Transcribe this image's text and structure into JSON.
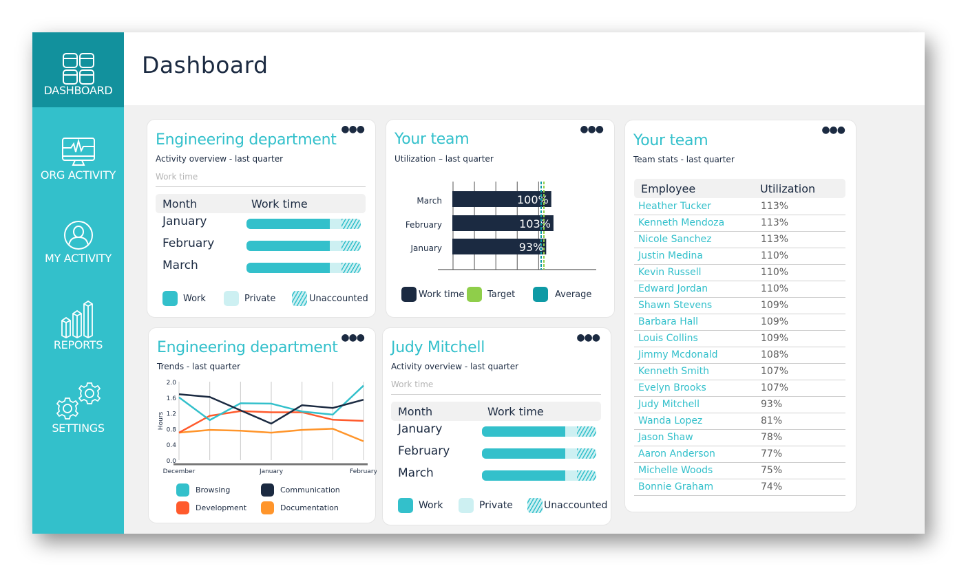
{
  "sidebar": {
    "items": [
      {
        "label": "DASHBOARD",
        "icon": "dashboard-grid-icon",
        "active": true
      },
      {
        "label": "ORG ACTIVITY",
        "icon": "monitor-pulse-icon",
        "active": false
      },
      {
        "label": "MY ACTIVITY",
        "icon": "user-circle-icon",
        "active": false
      },
      {
        "label": "REPORTS",
        "icon": "bar-chart-3d-icon",
        "active": false
      },
      {
        "label": "SETTINGS",
        "icon": "gears-icon",
        "active": false
      }
    ]
  },
  "header": {
    "title": "Dashboard"
  },
  "colors": {
    "accent": "#33c0cb",
    "accent_dark": "#12919d",
    "navy": "#1b2a41",
    "private": "#cdf0f2",
    "target": "#8fce4a",
    "average": "#0e9aa5"
  },
  "cards": {
    "eng_activity": {
      "title": "Engineering department",
      "subtitle": "Activity overview - last quarter",
      "section": "Work time",
      "col_month": "Month",
      "col_work": "Work time",
      "rows": [
        {
          "month": "January",
          "work": 0.73,
          "private": 0.1,
          "unaccounted": 0.17
        },
        {
          "month": "February",
          "work": 0.73,
          "private": 0.1,
          "unaccounted": 0.17
        },
        {
          "month": "March",
          "work": 0.73,
          "private": 0.1,
          "unaccounted": 0.17
        }
      ],
      "legend": [
        "Work",
        "Private",
        "Unaccounted"
      ]
    },
    "team_util": {
      "title": "Your team",
      "subtitle": "Utilization – last quarter",
      "legend": [
        "Work time",
        "Target",
        "Average"
      ]
    },
    "eng_trends": {
      "title": "Engineering department",
      "subtitle": "Trends - last quarter"
    },
    "judy": {
      "title": "Judy Mitchell",
      "subtitle": "Activity overview - last quarter",
      "section": "Work time",
      "col_month": "Month",
      "col_work": "Work time",
      "rows": [
        {
          "month": "January",
          "work": 0.73,
          "private": 0.1,
          "unaccounted": 0.17
        },
        {
          "month": "February",
          "work": 0.73,
          "private": 0.1,
          "unaccounted": 0.17
        },
        {
          "month": "March",
          "work": 0.73,
          "private": 0.1,
          "unaccounted": 0.17
        }
      ],
      "legend": [
        "Work",
        "Private",
        "Unaccounted"
      ]
    },
    "team_stats": {
      "title": "Your team",
      "subtitle": "Team stats - last quarter",
      "col_employee": "Employee",
      "col_util": "Utilization",
      "rows": [
        {
          "name": "Heather Tucker",
          "util": "113%"
        },
        {
          "name": "Kenneth Mendoza",
          "util": "113%"
        },
        {
          "name": "Nicole Sanchez",
          "util": "113%"
        },
        {
          "name": "Justin Medina",
          "util": "110%"
        },
        {
          "name": "Kevin Russell",
          "util": "110%"
        },
        {
          "name": "Edward Jordan",
          "util": "110%"
        },
        {
          "name": "Shawn Stevens",
          "util": "109%"
        },
        {
          "name": "Barbara Hall",
          "util": "109%"
        },
        {
          "name": "Louis Collins",
          "util": "109%"
        },
        {
          "name": "Jimmy Mcdonald",
          "util": "108%"
        },
        {
          "name": "Kenneth Smith",
          "util": "107%"
        },
        {
          "name": "Evelyn Brooks",
          "util": "107%"
        },
        {
          "name": "Judy Mitchell",
          "util": "93%"
        },
        {
          "name": "Wanda Lopez",
          "util": "81%"
        },
        {
          "name": "Jason Shaw",
          "util": "78%"
        },
        {
          "name": "Aaron Anderson",
          "util": "77%"
        },
        {
          "name": "Michelle Woods",
          "util": "75%"
        },
        {
          "name": "Bonnie Graham",
          "util": "74%"
        }
      ]
    }
  },
  "chart_data": [
    {
      "type": "bar",
      "orientation": "horizontal",
      "title": "Utilization – last quarter",
      "categories": [
        "March",
        "February",
        "January"
      ],
      "values": [
        100,
        103,
        93
      ],
      "value_labels": [
        "100%",
        "103%",
        "93%"
      ],
      "xlim": [
        0,
        140
      ],
      "reference_lines": [
        {
          "name": "Average",
          "value": 103.5
        },
        {
          "name": "Target",
          "value": 106
        }
      ],
      "grid": true,
      "legend": [
        "Work time",
        "Target",
        "Average"
      ]
    },
    {
      "type": "line",
      "title": "Trends - last quarter",
      "ylabel": "Hours",
      "ylim": [
        0,
        2.0
      ],
      "yticks": [
        "0.0",
        "0.4",
        "0.8",
        "1.2",
        "1.6",
        "2.0"
      ],
      "x_tick_labels": [
        "December",
        "",
        "",
        "January",
        "",
        "",
        "February"
      ],
      "grid": true,
      "legend_position": "bottom",
      "series": [
        {
          "name": "Browsing",
          "color": "#33c0cb",
          "values": [
            1.6,
            1.02,
            1.45,
            1.44,
            1.24,
            1.16,
            1.9
          ]
        },
        {
          "name": "Communication",
          "color": "#1b2a41",
          "values": [
            1.68,
            1.61,
            1.27,
            0.93,
            1.4,
            1.33,
            1.54
          ]
        },
        {
          "name": "Development",
          "color": "#ff5a2c",
          "values": [
            0.7,
            1.13,
            1.25,
            1.22,
            1.22,
            1.03,
            1.0
          ]
        },
        {
          "name": "Documentation",
          "color": "#ff952b",
          "values": [
            0.7,
            0.77,
            0.75,
            0.7,
            0.77,
            0.8,
            0.48
          ]
        }
      ]
    }
  ]
}
